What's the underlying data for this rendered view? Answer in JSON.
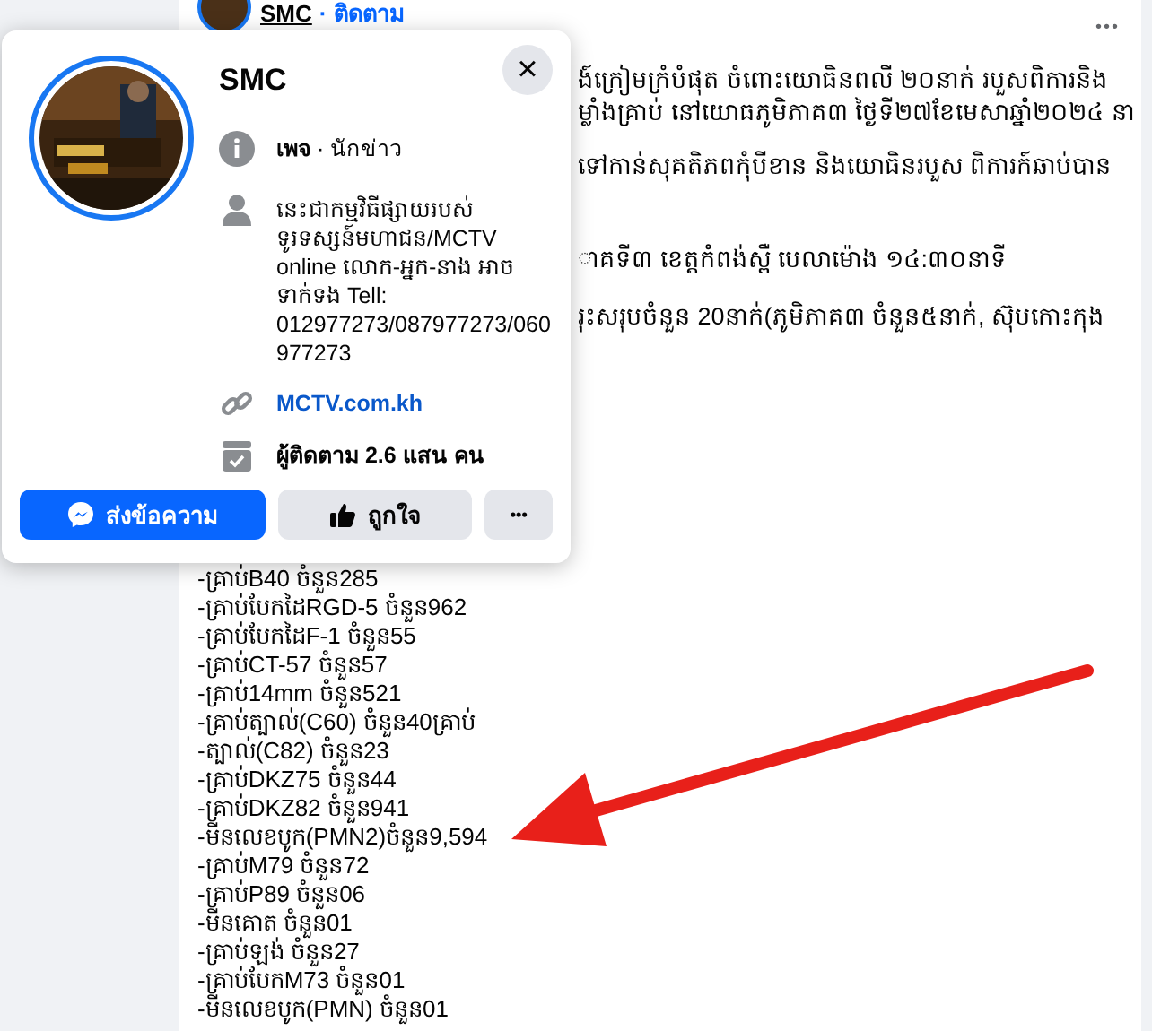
{
  "post": {
    "author": "SMC",
    "follow": "· ติดตาม",
    "menu": "•••",
    "paragraphs": [
      [
        "ង៍ក្រៀមក្រំបំផុត ចំពោះយោធិនពលី ២០នាក់ របួសពិការនិង",
        "ម្លាំងគ្រាប់ នៅយោធភូមិភាគ៣ ថ្ងៃទី២៧ខែមេសាឆ្នាំ២០២៤ នា"
      ],
      [
        "ទៅកាន់សុគតិភពកុំបីខាន និងយោធិនរបួស ពិការក៍ឆាប់បាន"
      ],
      [
        "ាគទី៣ ខេត្តកំពង់ស្ពឺ បេលាម៉ោង ១៤:៣០នាទី"
      ],
      [
        "រុះសរុបចំនួន 20នាក់(ភូមិភាគ៣ ចំនួន៥នាក់, ស៊ុបកោះកុង"
      ]
    ],
    "list": [
      "-គ្រាប់B40 ចំនួន285",
      "-គ្រាប់បែកដៃRGD-5 ចំនួន962",
      "-គ្រាប់បែកដៃF-1 ចំនួន55",
      "-គ្រាប់CT-57 ចំនួន57",
      "-គ្រាប់14mm ចំនួន521",
      "-គ្រាប់ត្បាល់(C60) ចំនួន40គ្រាប់",
      "-ត្បាល់(C82) ចំនួន23",
      "-គ្រាប់DKZ75 ចំនួន44",
      "-គ្រាប់DKZ82 ចំនួន941",
      "-មីនលេខបូក(PMN2)ចំនួន9,594",
      "-គ្រាប់M79 ចំនួន72",
      "-គ្រាប់P89 ចំនួន06",
      "-មីនគោត ចំនួន01",
      "-គ្រាប់ឡង់ ចំនួន27",
      "-គ្រាប់បែកM73 ចំនួន01",
      "-មីនលេខបូក(PMN) ចំនួន01"
    ]
  },
  "card": {
    "name": "SMC",
    "close": "×",
    "rows": [
      {
        "kind": "info",
        "text": "เพจ",
        "extra": " · นักข่าว"
      },
      {
        "kind": "person",
        "text": "នេះជាកម្មវិធីផ្សាយរបស់ ទូរទស្សន៍មហាជន/MCTV online លោក-អ្នក-នាង អាចទាក់ទង Tell: 012977273/087977273/060977273"
      },
      {
        "kind": "link",
        "text": "MCTV.com.kh"
      },
      {
        "kind": "followers",
        "text": "ผู้ติดตาม 2.6 แสน คน"
      }
    ],
    "message": "ส่งข้อความ",
    "like": "ถูกใจ",
    "more": "•••"
  }
}
